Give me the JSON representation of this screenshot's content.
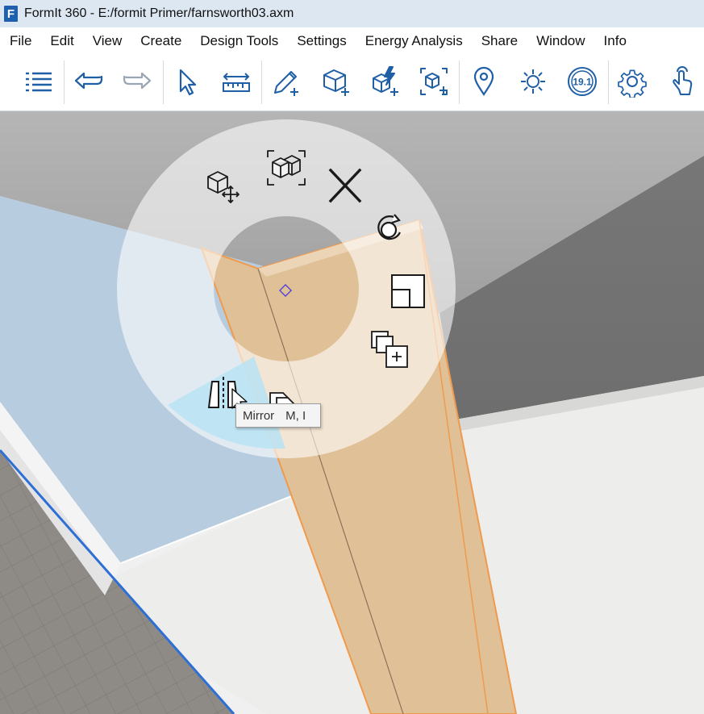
{
  "window": {
    "title": "FormIt 360 - E:/formit Primer/farnsworth03.axm",
    "logo_letter": "F"
  },
  "menu": [
    {
      "label": "File"
    },
    {
      "label": "Edit"
    },
    {
      "label": "View"
    },
    {
      "label": "Create"
    },
    {
      "label": "Design Tools"
    },
    {
      "label": "Settings"
    },
    {
      "label": "Energy Analysis"
    },
    {
      "label": "Share"
    },
    {
      "label": "Window"
    },
    {
      "label": "Info"
    }
  ],
  "toolbar": {
    "version_badge": "19.1",
    "icons": [
      "list-icon",
      "undo-icon",
      "redo-icon",
      "select-icon",
      "measure-icon",
      "sketch-icon",
      "solid-cube-icon",
      "dynamo-icon",
      "group-icon",
      "location-icon",
      "sun-icon",
      "version-badge-icon",
      "settings-icon",
      "touch-icon"
    ],
    "accent_color": "#1f5fa6"
  },
  "context_menu": {
    "items": [
      "move-icon",
      "group-icon",
      "delete-icon",
      "rotate-icon",
      "scale-icon",
      "copy-icon",
      "mirror-icon",
      "paste-icon"
    ],
    "highlighted": "mirror",
    "highlight_color": "#b8e3f3"
  },
  "tooltip": {
    "label": "Mirror",
    "shortcut": "M, I"
  }
}
